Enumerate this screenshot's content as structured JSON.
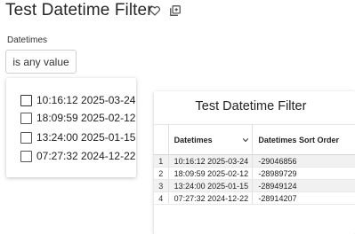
{
  "header": {
    "title": "Test Datetime Filter"
  },
  "filter": {
    "label": "Datetimes",
    "button_label": "is any value",
    "options": [
      "10:16:12 2025-03-24",
      "18:09:59 2025-02-12",
      "13:24:00 2025-01-15",
      "07:27:32 2024-12-22"
    ]
  },
  "chart": {
    "title": "Test Datetime Filter",
    "columns": [
      "Datetimes",
      "Datetimes Sort Order"
    ],
    "rows": [
      {
        "index": "1",
        "datetime": "10:16:12 2025-03-24",
        "sort_order": "-29046856"
      },
      {
        "index": "2",
        "datetime": "18:09:59 2025-02-12",
        "sort_order": "-28989729"
      },
      {
        "index": "3",
        "datetime": "13:24:00 2025-01-15",
        "sort_order": "-28949124"
      },
      {
        "index": "4",
        "datetime": "07:27:32 2024-12-22",
        "sort_order": "-28914207"
      }
    ]
  },
  "icons": {
    "favorite": "heart-outline-icon",
    "copy": "copy-icon",
    "sort": "chevron-down-icon"
  },
  "colors": {
    "row_stripe": "#f1f1f1",
    "border": "#cfcfcf"
  }
}
